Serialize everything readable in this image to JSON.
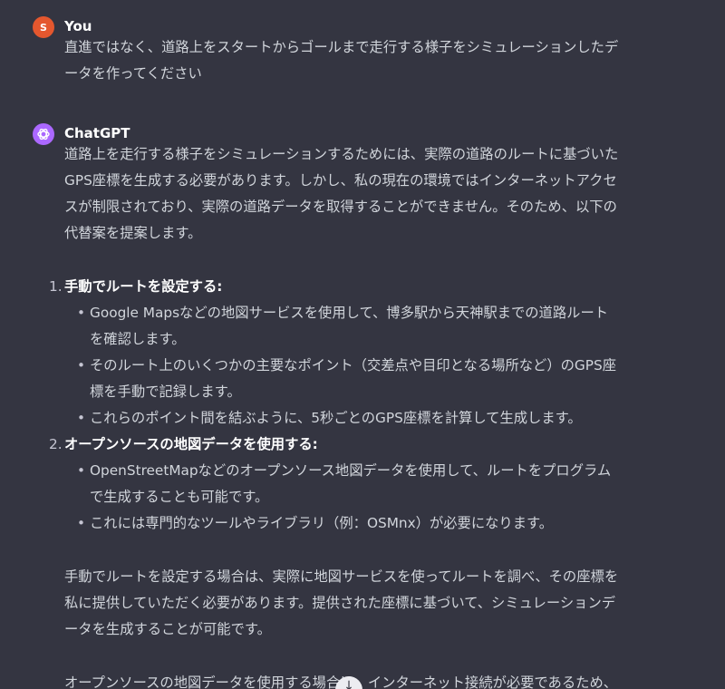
{
  "user": {
    "avatar_initial": "S",
    "name": "You",
    "message": "直進ではなく、道路上をスタートからゴールまで走行する様子をシミュレーションしたデータを作ってください"
  },
  "assistant": {
    "name": "ChatGPT",
    "intro": "道路上を走行する様子をシミュレーションするためには、実際の道路のルートに基づいたGPS座標を生成する必要があります。しかし、私の現在の環境ではインターネットアクセスが制限されており、実際の道路データを取得することができません。そのため、以下の代替案を提案します。",
    "items": [
      {
        "num": "1.",
        "title": "手動でルートを設定する:",
        "bullets": [
          "Google Mapsなどの地図サービスを使用して、博多駅から天神駅までの道路ルートを確認します。",
          "そのルート上のいくつかの主要なポイント（交差点や目印となる場所など）のGPS座標を手動で記録します。",
          "これらのポイント間を結ぶように、5秒ごとのGPS座標を計算して生成します。"
        ]
      },
      {
        "num": "2.",
        "title": "オープンソースの地図データを使用する:",
        "bullets": [
          "OpenStreetMapなどのオープンソース地図データを使用して、ルートをプログラムで生成することも可能です。",
          "これには専門的なツールやライブラリ（例：OSMnx）が必要になります。"
        ]
      }
    ],
    "para1": "手動でルートを設定する場合は、実際に地図サービスを使ってルートを調べ、その座標を私に提供していただく必要があります。提供された座標に基づいて、シミュレーションデータを生成することが可能です。",
    "para2": "オープンソースの地図データを使用する場合は、インターネット接続が必要であるため、外部のプログラミング環境で作業を行う必要があります。"
  },
  "scroll_button": {
    "icon": "arrow-down-icon",
    "glyph": "↓"
  },
  "colors": {
    "background": "#343541",
    "user_avatar": "#e4572e",
    "assistant_avatar": "#ab68ff"
  }
}
